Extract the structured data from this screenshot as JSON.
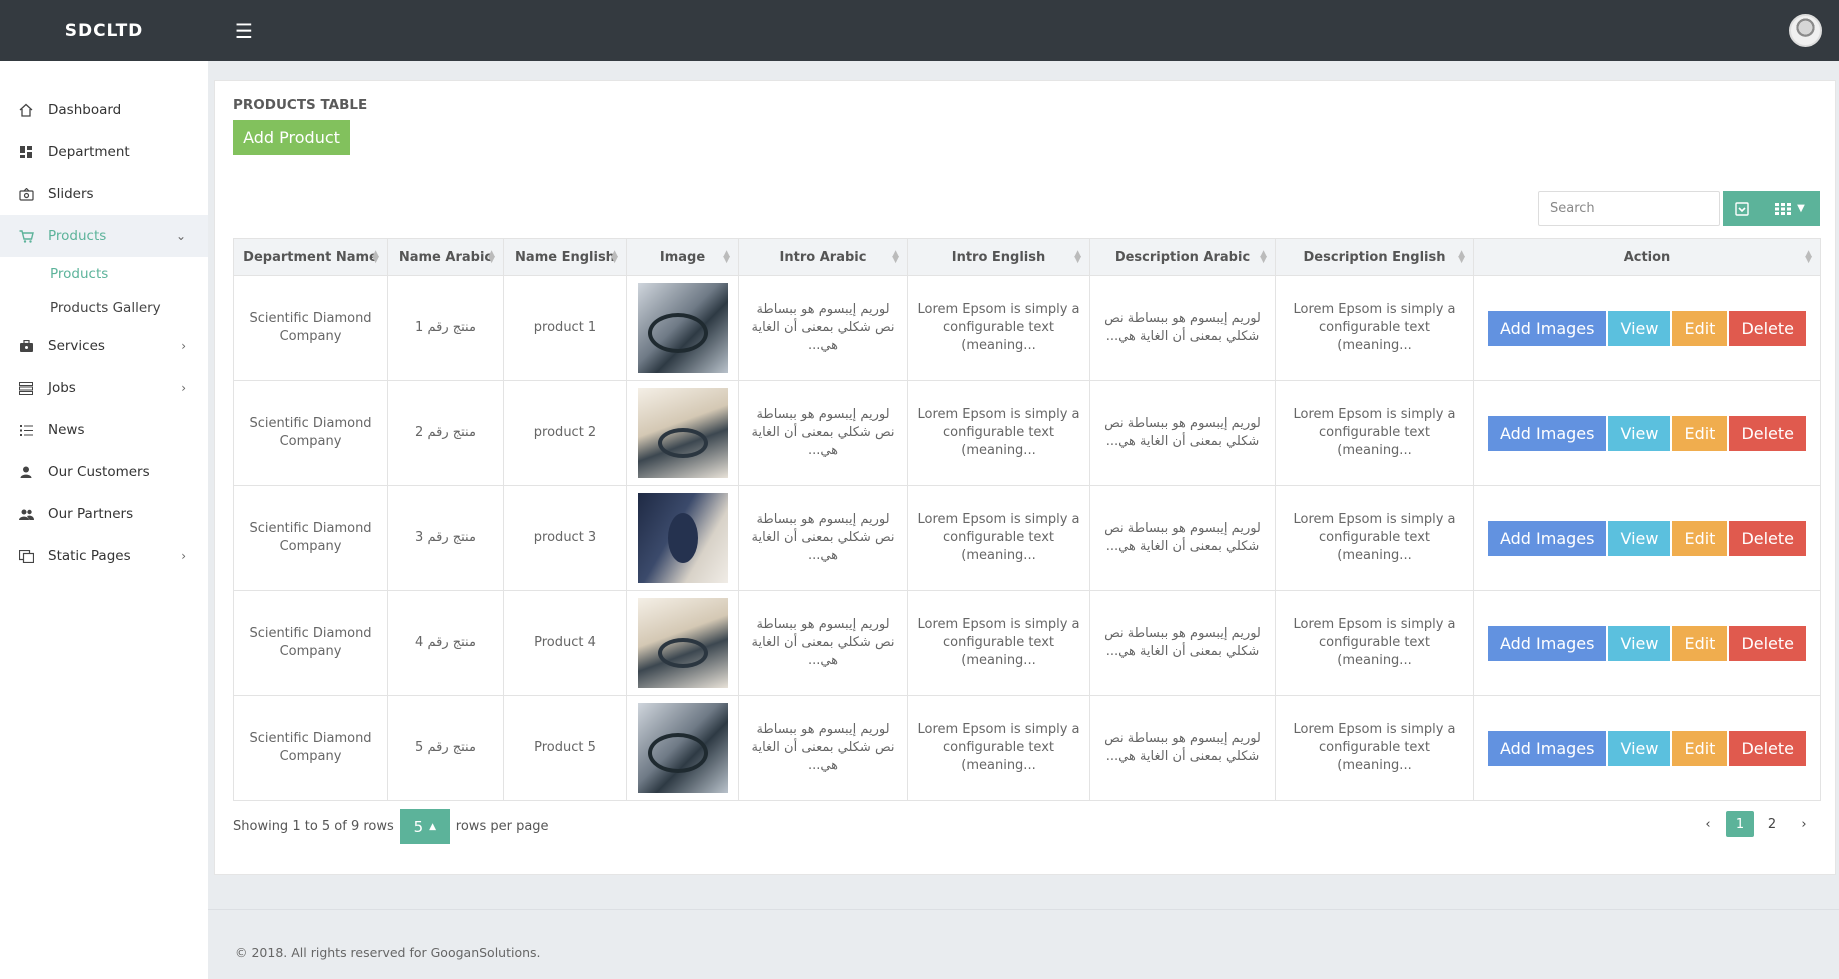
{
  "app": {
    "brand": "SDCLTD"
  },
  "sidebar": {
    "items": [
      {
        "label": "Dashboard",
        "icon": "home-icon"
      },
      {
        "label": "Department",
        "icon": "grid-icon"
      },
      {
        "label": "Sliders",
        "icon": "sliders-icon"
      },
      {
        "label": "Products",
        "icon": "cart-icon"
      },
      {
        "label": "Services",
        "icon": "briefcase-icon"
      },
      {
        "label": "Jobs",
        "icon": "list-icon"
      },
      {
        "label": "News",
        "icon": "news-icon"
      },
      {
        "label": "Our Customers",
        "icon": "user-icon"
      },
      {
        "label": "Our Partners",
        "icon": "users-icon"
      },
      {
        "label": "Static Pages",
        "icon": "pages-icon"
      }
    ],
    "sub": [
      "Products",
      "Products Gallery"
    ]
  },
  "main": {
    "title": "PRODUCTS TABLE",
    "add_label": "Add Product",
    "search_placeholder": "Search"
  },
  "table": {
    "headers": [
      "Department Name",
      "Name Arabic",
      "Name English",
      "Image",
      "Intro Arabic",
      "Intro English",
      "Description Arabic",
      "Description English",
      "Action"
    ],
    "rows": [
      {
        "dept": "Scientific Diamond Company",
        "name_ar": "منتج رقم 1",
        "name_en": "product 1",
        "intro_ar": "لوريم إيبسوم هو ببساطة نص شكلي بمعنى أن الغاية هي...",
        "intro_en": "Lorem Epsom is simply a configurable text (meaning...",
        "desc_ar": "لوريم إيبسوم هو ببساطة نص شكلي بمعنى أن الغاية هي...",
        "desc_en": "Lorem Epsom is simply a configurable text (meaning..."
      },
      {
        "dept": "Scientific Diamond Company",
        "name_ar": "منتج رقم 2",
        "name_en": "product 2",
        "intro_ar": "لوريم إيبسوم هو ببساطة نص شكلي بمعنى أن الغاية هي...",
        "intro_en": "Lorem Epsom is simply a configurable text (meaning...",
        "desc_ar": "لوريم إيبسوم هو ببساطة نص شكلي بمعنى أن الغاية هي...",
        "desc_en": "Lorem Epsom is simply a configurable text (meaning..."
      },
      {
        "dept": "Scientific Diamond Company",
        "name_ar": "منتج رقم 3",
        "name_en": "product 3",
        "intro_ar": "لوريم إيبسوم هو ببساطة نص شكلي بمعنى أن الغاية هي...",
        "intro_en": "Lorem Epsom is simply a configurable text (meaning...",
        "desc_ar": "لوريم إيبسوم هو ببساطة نص شكلي بمعنى أن الغاية هي...",
        "desc_en": "Lorem Epsom is simply a configurable text (meaning..."
      },
      {
        "dept": "Scientific Diamond Company",
        "name_ar": "منتج رقم 4",
        "name_en": "Product 4",
        "intro_ar": "لوريم إيبسوم هو ببساطة نص شكلي بمعنى أن الغاية هي...",
        "intro_en": "Lorem Epsom is simply a configurable text (meaning...",
        "desc_ar": "لوريم إيبسوم هو ببساطة نص شكلي بمعنى أن الغاية هي...",
        "desc_en": "Lorem Epsom is simply a configurable text (meaning..."
      },
      {
        "dept": "Scientific Diamond Company",
        "name_ar": "منتج رقم 5",
        "name_en": "Product 5",
        "intro_ar": "لوريم إيبسوم هو ببساطة نص شكلي بمعنى أن الغاية هي...",
        "intro_en": "Lorem Epsom is simply a configurable text (meaning...",
        "desc_ar": "لوريم إيبسوم هو ببساطة نص شكلي بمعنى أن الغاية هي...",
        "desc_en": "Lorem Epsom is simply a configurable text (meaning..."
      }
    ],
    "actions": {
      "add_images": "Add Images",
      "view": "View",
      "edit": "Edit",
      "delete": "Delete"
    }
  },
  "pagination": {
    "showing": "Showing 1 to 5 of 9 rows",
    "per_page": "5",
    "rows_per_page": "rows per page",
    "prev": "‹",
    "pages": [
      "1",
      "2"
    ],
    "next": "›"
  },
  "footer": {
    "text": "© 2018. All rights reserved for GooganSolutions."
  },
  "colors": {
    "topbar": "#343a40",
    "accent": "#5cb39a",
    "add": "#82c15d",
    "add_images": "#6292e0",
    "view": "#5bc0de",
    "edit": "#f0ad4e",
    "delete": "#e05a4e"
  }
}
